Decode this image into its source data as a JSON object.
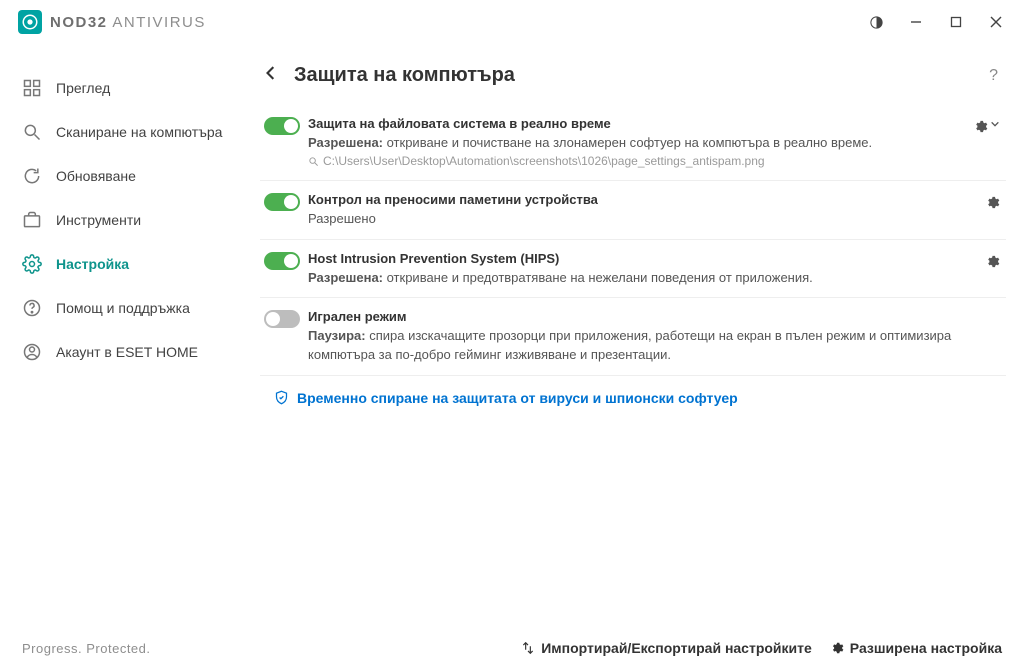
{
  "brand": {
    "name_strong": "NOD32",
    "name_light": " ANTIVIRUS"
  },
  "sidebar": {
    "items": [
      {
        "label": "Преглед"
      },
      {
        "label": "Сканиране на компютъра"
      },
      {
        "label": "Обновяване"
      },
      {
        "label": "Инструменти"
      },
      {
        "label": "Настройка"
      },
      {
        "label": "Помощ и поддръжка"
      },
      {
        "label": "Акаунт в ESET HOME"
      }
    ]
  },
  "page": {
    "title": "Защита на компютъра",
    "help": "?"
  },
  "settings": [
    {
      "title": "Защита на файловата система в реално време",
      "status_label": "Разрешена:",
      "desc": " откриване и почистване на злонамерен софтуер на компютъра в реално време.",
      "path": "C:\\Users\\User\\Desktop\\Automation\\screenshots\\1026\\page_settings_antispam.png",
      "on": true,
      "gear_dropdown": true
    },
    {
      "title": "Контрол на преносими паметини устройства",
      "status_label": "Разрешено",
      "desc": "",
      "on": true,
      "gear_dropdown": false
    },
    {
      "title": "Host Intrusion Prevention System (HIPS)",
      "status_label": "Разрешена:",
      "desc": " откриване и предотвратяване на нежелани поведения от приложения.",
      "on": true,
      "gear_dropdown": false
    },
    {
      "title": "Игрален режим",
      "status_label": "Паузира:",
      "desc": " спира изскачащите прозорци при приложения, работещи на екран в пълен режим и оптимизира компютъра за по-добро гейминг изживяване и презентации.",
      "on": false,
      "gear_dropdown": false,
      "no_gear": true
    }
  ],
  "pause_link": "Временно спиране на защитата от вируси и шпионски софтуер",
  "footer": {
    "tagline": "Progress. Protected.",
    "import_export": "Импортирай/Експортирай настройките",
    "advanced": "Разширена настройка"
  }
}
